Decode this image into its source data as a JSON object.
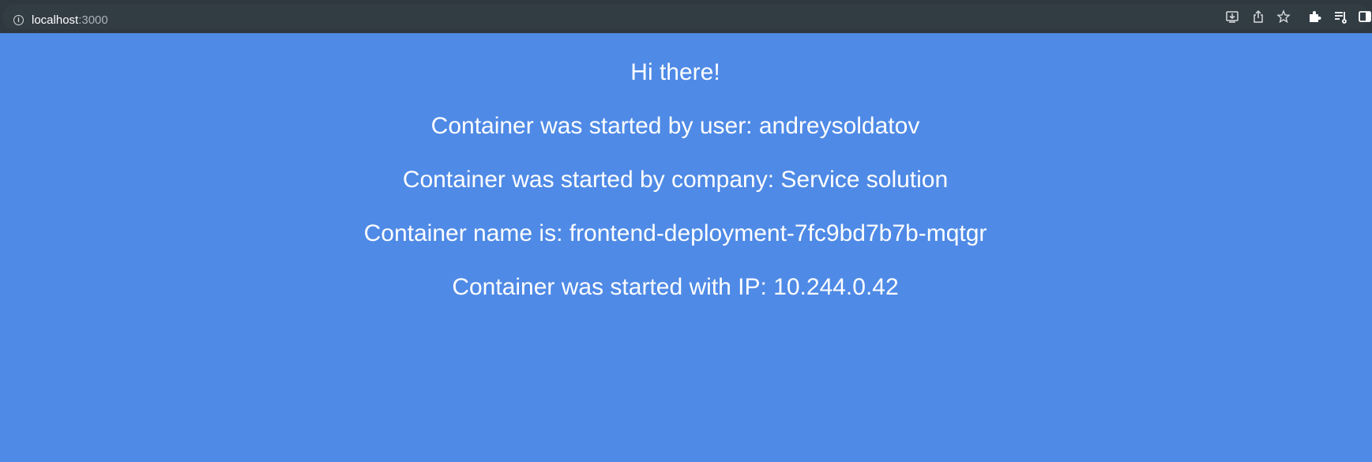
{
  "browser": {
    "url_host": "localhost",
    "url_port": ":3000",
    "icons": [
      "info-icon",
      "install-app-icon",
      "share-icon",
      "bookmark-star-icon",
      "extensions-icon",
      "reading-list-icon",
      "side-panel-icon"
    ]
  },
  "page": {
    "background": "#4f8ae6",
    "lines": [
      "Hi there!",
      "Container was started by user: andreysoldatov",
      "Container was started by company: Service solution",
      "Container name is: frontend-deployment-7fc9bd7b7b-mqtgr",
      "Container was started with IP: 10.244.0.42"
    ]
  }
}
